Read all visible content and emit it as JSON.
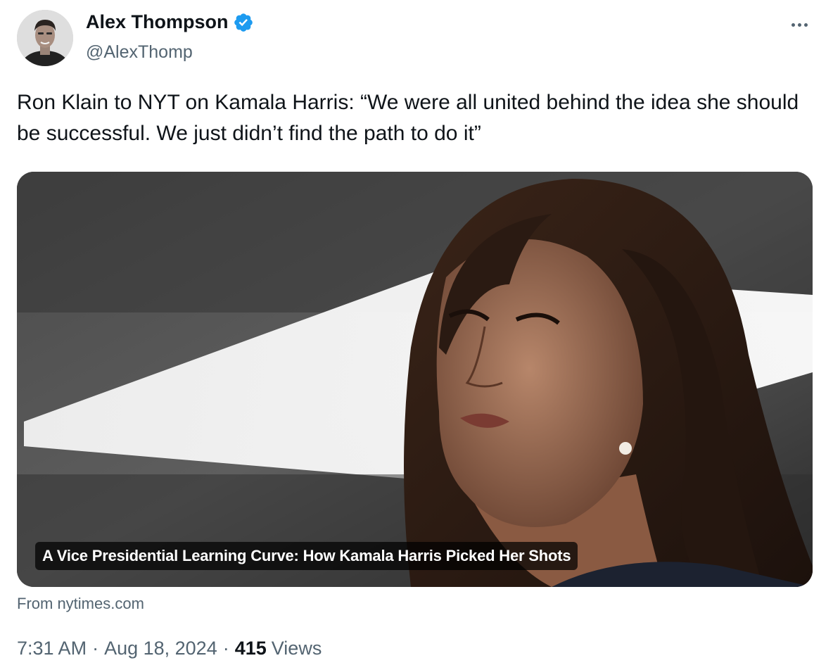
{
  "author": {
    "name": "Alex Thompson",
    "handle": "@AlexThomp",
    "verified": true,
    "avatar_icon": "profile-photo"
  },
  "menu_icon": "more-horizontal-icon",
  "tweet": {
    "text": "Ron Klain to NYT on Kamala Harris: “We were all united behind the idea she should be successful. We just didn’t find the path to do it”"
  },
  "card": {
    "title": "A Vice Presidential Learning Curve: How Kamala Harris Picked Her Shots",
    "source": "From nytimes.com"
  },
  "meta": {
    "time": "7:31 AM",
    "separator": "·",
    "date": "Aug 18, 2024",
    "views_count": "415",
    "views_label": "Views"
  },
  "colors": {
    "verified_badge": "#1d9bf0",
    "secondary_text": "#536471",
    "primary_text": "#0f1419"
  }
}
